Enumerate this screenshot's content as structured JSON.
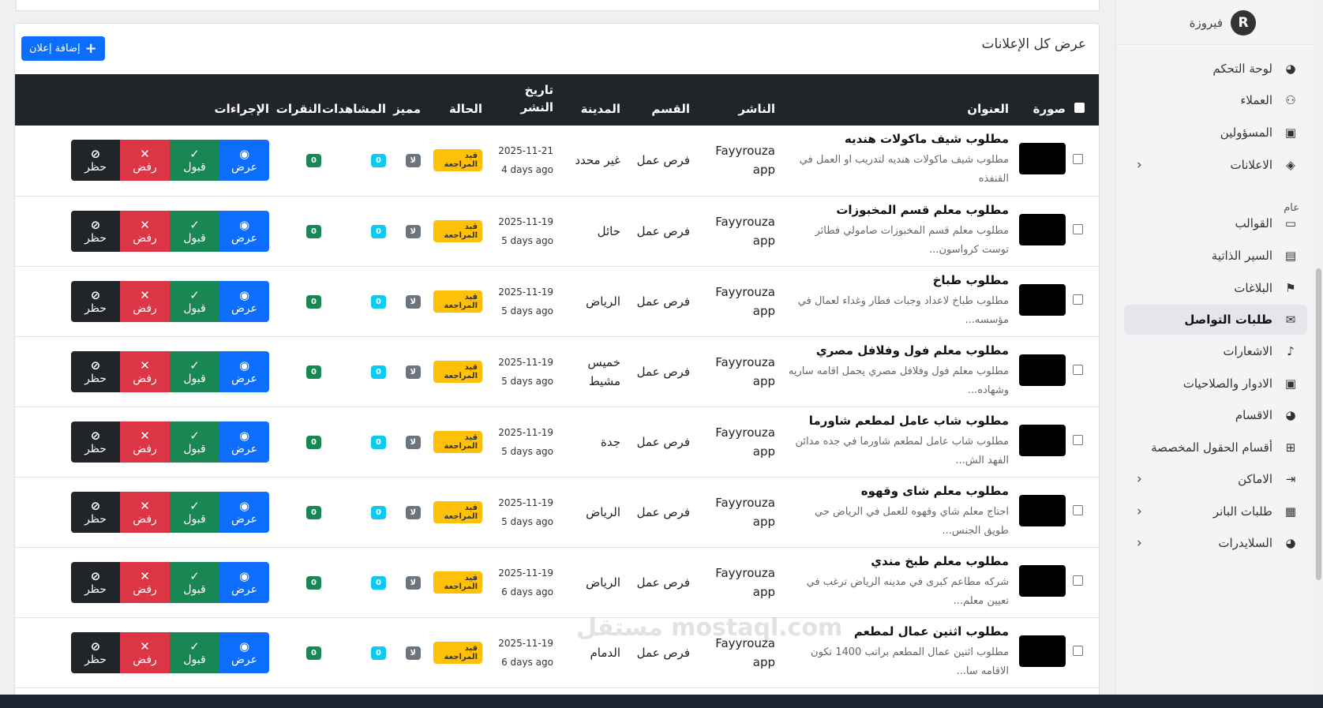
{
  "header": {
    "title": "عرض كل الإعلانات",
    "add_button": "إضافة إعلان"
  },
  "table": {
    "columns": {
      "image": "صورة",
      "title": "العنوان",
      "publisher": "الناشر",
      "category": "القسم",
      "city": "المدينة",
      "date": "تاريخ النشر",
      "status": "الحالة",
      "featured": "مميز",
      "views": "المشاهدات",
      "clicks": "النقرات",
      "actions": "الإجراءات"
    },
    "actions": {
      "view": "عرض",
      "accept": "قبول",
      "reject": "رفض",
      "ban": "حظر"
    },
    "rows": [
      {
        "title": "مطلوب شيف ماكولات هنديه",
        "desc": "مطلوب شيف ماكولات هنديه لتدريب او العمل في القنفذه",
        "publisher": "Fayyrouza app",
        "category": "فرص عمل",
        "city": "غير محدد",
        "date": "2025-11-21",
        "ago": "4 days ago",
        "status": "قيد المراجعة",
        "featured": "لا",
        "views": "0",
        "clicks": "0"
      },
      {
        "title": "مطلوب معلم قسم المخبوزات",
        "desc": "مطلوب معلم قسم المخبوزات صامولي فطائر توست كرواسون...",
        "publisher": "Fayyrouza app",
        "category": "فرص عمل",
        "city": "حائل",
        "date": "2025-11-19",
        "ago": "5 days ago",
        "status": "قيد المراجعة",
        "featured": "لا",
        "views": "0",
        "clicks": "0"
      },
      {
        "title": "مطلوب طباخ",
        "desc": "مطلوب طباخ لاعداد وجبات فطار وغداء لعمال في مؤسسه...",
        "publisher": "Fayyrouza app",
        "category": "فرص عمل",
        "city": "الرياض",
        "date": "2025-11-19",
        "ago": "5 days ago",
        "status": "قيد المراجعة",
        "featured": "لا",
        "views": "0",
        "clicks": "0"
      },
      {
        "title": "مطلوب معلم فول وفلافل مصري",
        "desc": "مطلوب معلم فول وفلافل مصري يحمل اقامه ساريه وشهاده...",
        "publisher": "Fayyrouza app",
        "category": "فرص عمل",
        "city": "خميس مشيط",
        "date": "2025-11-19",
        "ago": "5 days ago",
        "status": "قيد المراجعة",
        "featured": "لا",
        "views": "0",
        "clicks": "0"
      },
      {
        "title": "مطلوب شاب عامل لمطعم شاورما",
        "desc": "مطلوب شاب عامل لمطعم شاورما في جده مدائن الفهد الش...",
        "publisher": "Fayyrouza app",
        "category": "فرص عمل",
        "city": "جدة",
        "date": "2025-11-19",
        "ago": "5 days ago",
        "status": "قيد المراجعة",
        "featured": "لا",
        "views": "0",
        "clicks": "0"
      },
      {
        "title": "مطلوب معلم شاى وقهوه",
        "desc": "احتاج معلم شاي وقهوه للعمل في الرياض حي طويق الجنس...",
        "publisher": "Fayyrouza app",
        "category": "فرص عمل",
        "city": "الرياض",
        "date": "2025-11-19",
        "ago": "5 days ago",
        "status": "قيد المراجعة",
        "featured": "لا",
        "views": "0",
        "clicks": "0"
      },
      {
        "title": "مطلوب معلم طبخ مندي",
        "desc": "شركه مطاعم كبرى في مدينه الرياض ترغب في تعيين معلم...",
        "publisher": "Fayyrouza app",
        "category": "فرص عمل",
        "city": "الرياض",
        "date": "2025-11-19",
        "ago": "6 days ago",
        "status": "قيد المراجعة",
        "featured": "لا",
        "views": "0",
        "clicks": "0"
      },
      {
        "title": "مطلوب اثنين عمال لمطعم",
        "desc": "مطلوب اثنين عمال المطعم براتب 1400 تكون الاقامه سا...",
        "publisher": "Fayyrouza app",
        "category": "فرص عمل",
        "city": "الدمام",
        "date": "2025-11-19",
        "ago": "6 days ago",
        "status": "قيد المراجعة",
        "featured": "لا",
        "views": "0",
        "clicks": "0"
      }
    ]
  },
  "sidebar": {
    "brand": "فيروزة",
    "section_general": "عام",
    "items": [
      {
        "label": "لوحة التحكم",
        "icon": "palette-icon",
        "chevron": false,
        "active": false
      },
      {
        "label": "العملاء",
        "icon": "users-icon",
        "chevron": false,
        "active": false
      },
      {
        "label": "المسؤولين",
        "icon": "id-card-icon",
        "chevron": false,
        "active": false
      },
      {
        "label": "الاعلانات",
        "icon": "box-icon",
        "chevron": true,
        "active": false
      },
      {
        "label": "القوالب",
        "icon": "folder-icon",
        "chevron": false,
        "active": false
      },
      {
        "label": "السير الذاتية",
        "icon": "resume-icon",
        "chevron": false,
        "active": false
      },
      {
        "label": "البلاغات",
        "icon": "flag-icon",
        "chevron": false,
        "active": false
      },
      {
        "label": "طلبات التواصل",
        "icon": "envelope-icon",
        "chevron": false,
        "active": true
      },
      {
        "label": "الاشعارات",
        "icon": "bell-icon",
        "chevron": false,
        "active": false
      },
      {
        "label": "الادوار والصلاحيات",
        "icon": "id-card-icon",
        "chevron": false,
        "active": false
      },
      {
        "label": "الاقسام",
        "icon": "palette-icon",
        "chevron": false,
        "active": false
      },
      {
        "label": "أقسام الحقول المخصصة",
        "icon": "folder-plus-icon",
        "chevron": false,
        "active": false
      },
      {
        "label": "الاماكن",
        "icon": "sign-in-icon",
        "chevron": true,
        "active": false
      },
      {
        "label": "طلبات البانر",
        "icon": "ad-icon",
        "chevron": true,
        "active": false
      },
      {
        "label": "السلايدرات",
        "icon": "palette-icon",
        "chevron": true,
        "active": false
      }
    ]
  },
  "watermark": "مستقل mostaql.com"
}
